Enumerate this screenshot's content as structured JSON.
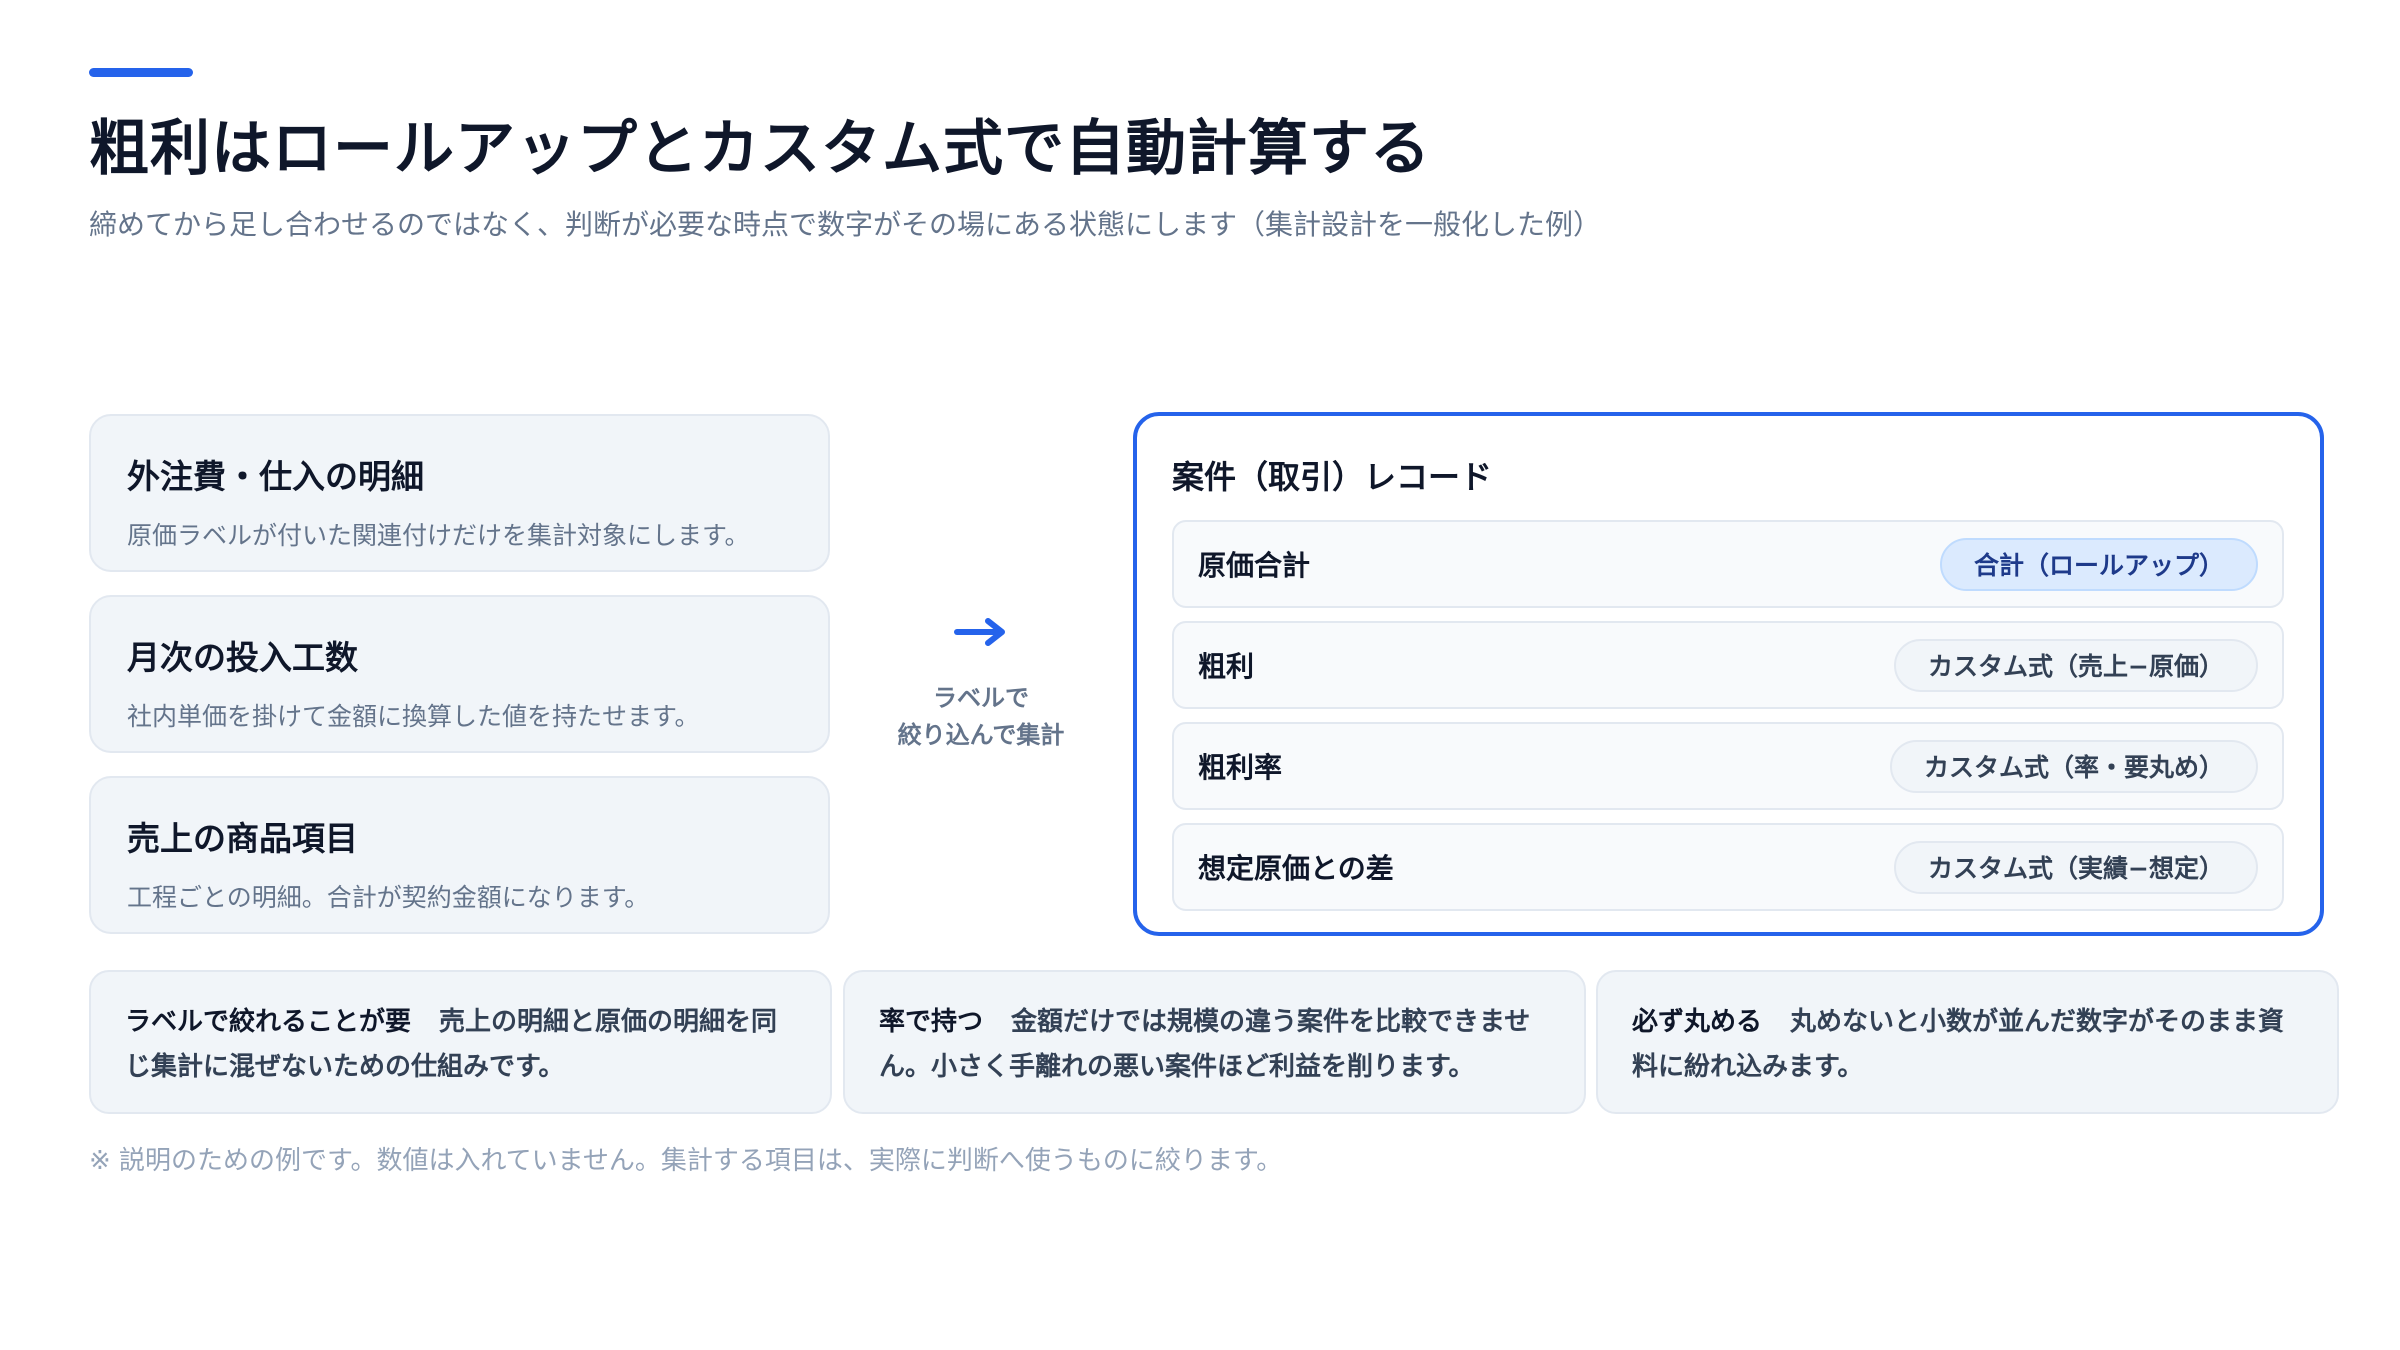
{
  "header": {
    "title": "粗利はロールアップとカスタム式で自動計算する",
    "subtitle": "締めてから足し合わせるのではなく、判断が必要な時点で数字がその場にある状態にします（集計設計を一般化した例）"
  },
  "sources": [
    {
      "title": "外注費・仕入の明細",
      "desc": "原価ラベルが付いた関連付けだけを集計対象にします。"
    },
    {
      "title": "月次の投入工数",
      "desc": "社内単価を掛けて金額に換算した値を持たせます。"
    },
    {
      "title": "売上の商品項目",
      "desc": "工程ごとの明細。合計が契約金額になります。"
    }
  ],
  "flow": {
    "arrow_icon": "arrow-right-icon",
    "label_line1": "ラベルで",
    "label_line2": "絞り込んで集計"
  },
  "record": {
    "title": "案件（取引）レコード",
    "fields": [
      {
        "name": "原価合計",
        "type": "合計（ロールアップ）"
      },
      {
        "name": "粗利",
        "type": "カスタム式（売上−原価）"
      },
      {
        "name": "粗利率",
        "type": "カスタム式（率・要丸め）"
      },
      {
        "name": "想定原価との差",
        "type": "カスタム式（実績−想定）"
      }
    ]
  },
  "notes": [
    {
      "key": "ラベルで絞れることが要",
      "text": "売上の明細と原価の明細を同じ集計に混ぜないための仕組みです。"
    },
    {
      "key": "率で持つ",
      "text": "金額だけでは規模の違う案件を比較できません。小さく手離れの悪い案件ほど利益を削ります。"
    },
    {
      "key": "必ず丸める",
      "text": "丸めないと小数が並んだ数字がそのまま資料に紛れ込みます。"
    }
  ],
  "footnote": "※ 説明のための例です。数値は入れていません。集計する項目は、実際に判断へ使うものに絞ります。",
  "colors": {
    "accent": "#2563eb",
    "card_bg": "#f1f5f9",
    "chip_rollup_bg": "#dbeafe"
  }
}
